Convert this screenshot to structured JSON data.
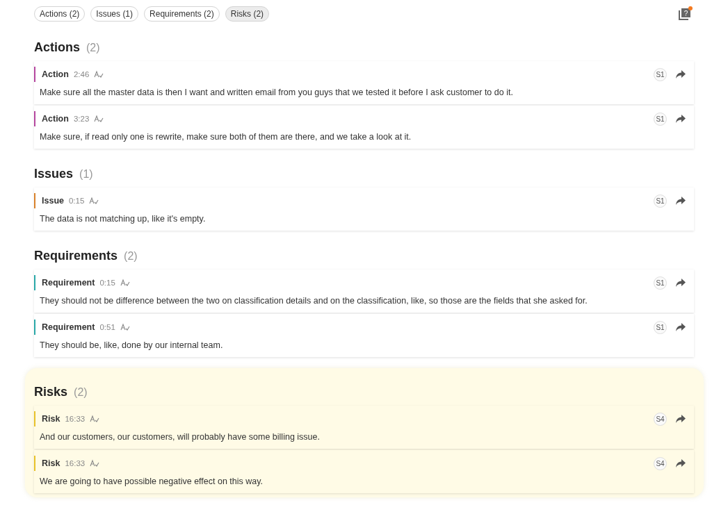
{
  "filters": [
    {
      "label": "Actions (2)",
      "selected": false
    },
    {
      "label": "Issues (1)",
      "selected": false
    },
    {
      "label": "Requirements (2)",
      "selected": false
    },
    {
      "label": "Risks (2)",
      "selected": true
    }
  ],
  "help": {
    "glyph": "?",
    "notification": true
  },
  "sections": [
    {
      "title": "Actions",
      "count": "(2)",
      "color": "#b5479f",
      "highlighted": false,
      "items": [
        {
          "label": "Action",
          "time": "2:46",
          "speaker": "S1",
          "text": "Make sure all the master data is then I want and written email from you guys that we tested it before I ask customer to do it."
        },
        {
          "label": "Action",
          "time": "3:23",
          "speaker": "S1",
          "text": "Make sure, if read only one is rewrite, make sure both of them are there, and we take a look at it."
        }
      ]
    },
    {
      "title": "Issues",
      "count": "(1)",
      "color": "#d9822b",
      "highlighted": false,
      "items": [
        {
          "label": "Issue",
          "time": "0:15",
          "speaker": "S1",
          "text": "The data is not matching up, like it's empty."
        }
      ]
    },
    {
      "title": "Requirements",
      "count": "(2)",
      "color": "#2aa8a8",
      "highlighted": false,
      "items": [
        {
          "label": "Requirement",
          "time": "0:15",
          "speaker": "S1",
          "text": "They should not be difference between the two on classification details and on the classification, like, so those are the fields that she asked for."
        },
        {
          "label": "Requirement",
          "time": "0:51",
          "speaker": "S1",
          "text": "They should be, like, done by our internal team."
        }
      ]
    },
    {
      "title": "Risks",
      "count": "(2)",
      "color": "#e8c22a",
      "highlighted": true,
      "items": [
        {
          "label": "Risk",
          "time": "16:33",
          "speaker": "S4",
          "text": "And our customers, our customers, will probably have some billing issue."
        },
        {
          "label": "Risk",
          "time": "16:33",
          "speaker": "S4",
          "text": "We are going to have possible negative effect on this way."
        }
      ]
    }
  ]
}
